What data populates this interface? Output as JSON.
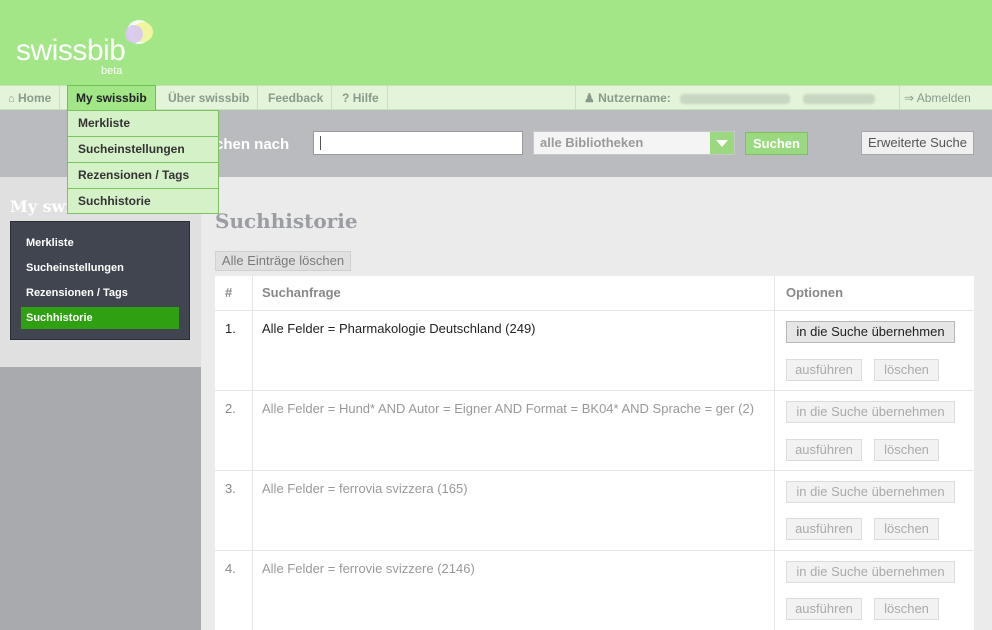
{
  "brand": {
    "name": "swissbib",
    "tag": "beta"
  },
  "nav": {
    "home": "Home",
    "my_swissbib": "My swissbib",
    "ueber": "Über swissbib",
    "feedback": "Feedback",
    "hilfe": "Hilfe",
    "username_label": "Nutzername:",
    "logout": "Abmelden"
  },
  "dropdown": [
    "Merkliste",
    "Sucheinstellungen",
    "Rezensionen / Tags",
    "Suchhistorie"
  ],
  "search": {
    "label": "chen nach",
    "input_value": "",
    "library_select": "alle Bibliotheken",
    "submit": "Suchen",
    "advanced": "Erweiterte Suche"
  },
  "sidebar": {
    "title": "My swiss",
    "items": [
      "Merkliste",
      "Sucheinstellungen",
      "Rezensionen / Tags",
      "Suchhistorie"
    ],
    "active_index": 3
  },
  "main": {
    "title": "Suchhistorie",
    "clear_all": "Alle Einträge löschen",
    "table": {
      "headers": {
        "num": "#",
        "query": "Suchanfrage",
        "options": "Optionen"
      },
      "rows": [
        {
          "num": "1.",
          "query": "Alle Felder = Pharmakologie Deutschland (249)"
        },
        {
          "num": "2.",
          "query": "Alle Felder = Hund* AND Autor = Eigner AND Format = BK04* AND Sprache = ger (2)"
        },
        {
          "num": "3.",
          "query": "Alle Felder = ferrovia svizzera (165)"
        },
        {
          "num": "4.",
          "query": "Alle Felder = ferrovie svizzere (2146)"
        }
      ],
      "buttons": {
        "take_over": "in die Suche übernehmen",
        "run": "ausführen",
        "delete": "löschen"
      }
    }
  },
  "colors": {
    "brand_green": "#a2e688",
    "active_green": "#2ea011",
    "sidebar_dark": "#404550"
  }
}
